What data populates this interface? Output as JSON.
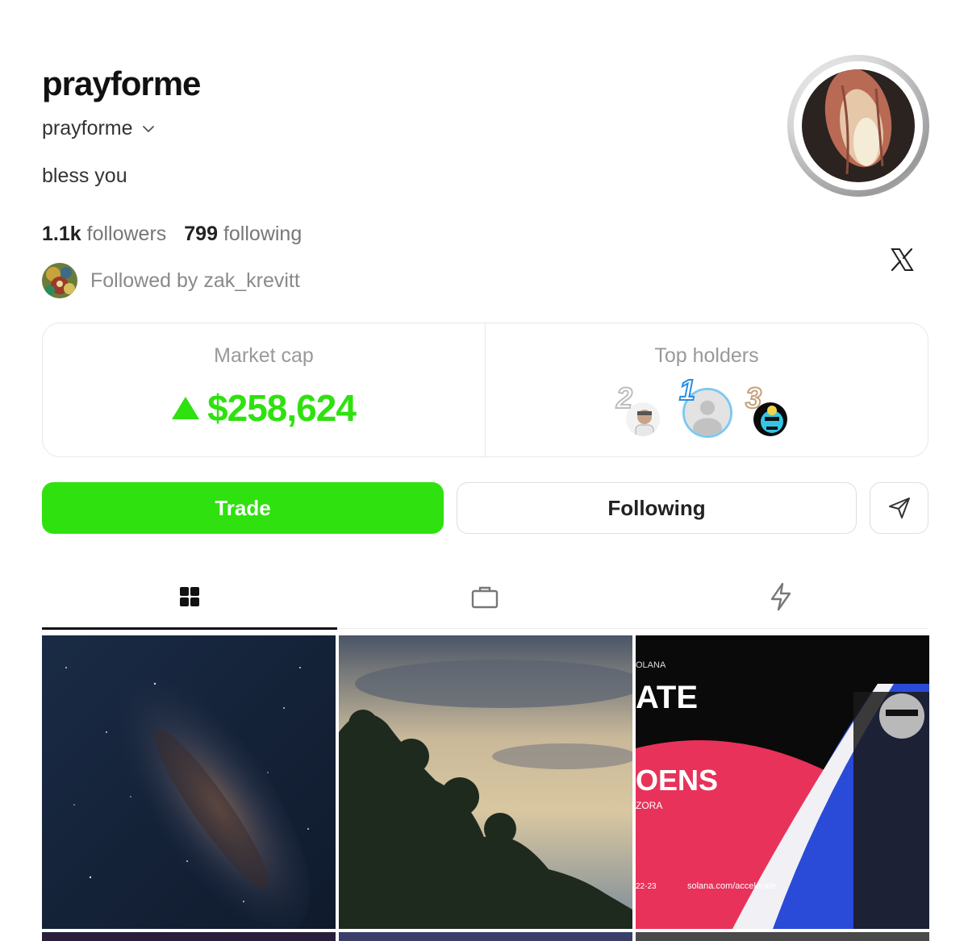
{
  "profile": {
    "display_name": "prayforme",
    "handle": "prayforme",
    "bio": "bless you",
    "followers_count": "1.1k",
    "followers_label": "followers",
    "following_count": "799",
    "following_label": "following",
    "followed_by": "Followed by zak_krevitt"
  },
  "stats": {
    "market_cap_label": "Market cap",
    "market_cap_value": "$258,624",
    "top_holders_label": "Top holders",
    "holders": [
      {
        "rank": "2"
      },
      {
        "rank": "1"
      },
      {
        "rank": "3"
      }
    ]
  },
  "actions": {
    "trade_label": "Trade",
    "following_label": "Following"
  },
  "tabs": [
    {
      "icon": "grid-icon",
      "active": true
    },
    {
      "icon": "bag-icon",
      "active": false
    },
    {
      "icon": "lightning-icon",
      "active": false
    }
  ],
  "posts": {
    "tile3_text_top": "OLANA",
    "tile3_text_ate": "ATE",
    "tile3_text_oens": "OENS",
    "tile3_text_zora": "ZORA",
    "tile3_text_date": "22-23",
    "tile3_text_url": "solana.com/accelerate"
  },
  "colors": {
    "accent_green": "#2fe10f",
    "text_dark": "#1a1a1a",
    "muted": "#999999"
  }
}
